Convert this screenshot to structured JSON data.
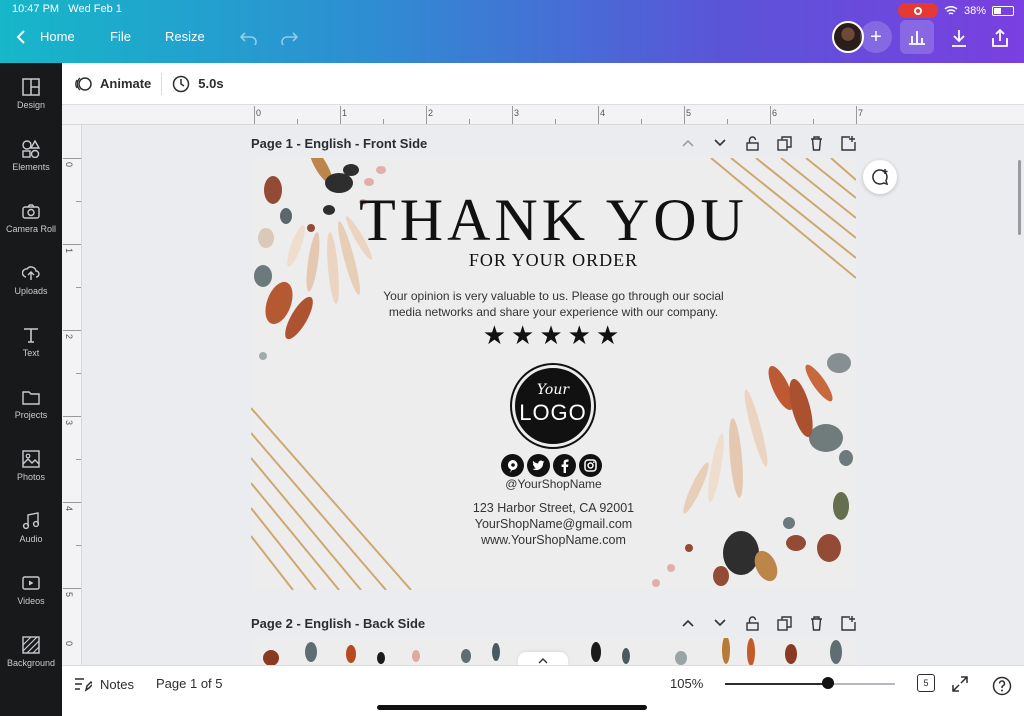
{
  "status_bar": {
    "time": "10:47 PM",
    "date": "Wed Feb 1",
    "battery": "38%"
  },
  "nav": {
    "home": "Home",
    "file": "File",
    "resize": "Resize"
  },
  "sidebar": {
    "items": [
      {
        "label": "Design",
        "icon": "design-icon"
      },
      {
        "label": "Elements",
        "icon": "elements-icon"
      },
      {
        "label": "Camera Roll",
        "icon": "camera-icon"
      },
      {
        "label": "Uploads",
        "icon": "upload-icon"
      },
      {
        "label": "Text",
        "icon": "text-icon"
      },
      {
        "label": "Projects",
        "icon": "folder-icon"
      },
      {
        "label": "Photos",
        "icon": "photo-icon"
      },
      {
        "label": "Audio",
        "icon": "music-icon"
      },
      {
        "label": "Videos",
        "icon": "video-icon"
      },
      {
        "label": "Background",
        "icon": "background-icon"
      }
    ]
  },
  "toolbar": {
    "animate": "Animate",
    "duration": "5.0s"
  },
  "ruler": {
    "top_labels": [
      "0",
      "1",
      "2",
      "3",
      "4",
      "5",
      "6",
      "7"
    ],
    "left_labels": [
      "0",
      "1",
      "2",
      "3",
      "4",
      "5",
      "0"
    ]
  },
  "pages": [
    {
      "title": "Page 1 - English - Front Side"
    },
    {
      "title": "Page 2 - English - Back Side"
    }
  ],
  "card": {
    "heading": "THANK YOU",
    "subheading": "FOR YOUR ORDER",
    "opinion_line1": "Your opinion is very valuable to us. Please go through our social",
    "opinion_line2": "media networks and share your experience with our company.",
    "stars": "★★★★★",
    "logo_top": "Your",
    "logo_main": "LOGO",
    "social_icons": [
      "pinterest-icon",
      "twitter-icon",
      "facebook-icon",
      "instagram-icon"
    ],
    "handle": "@YourShopName",
    "address": "123 Harbor Street, CA 92001",
    "email": "YourShopName@gmail.com",
    "website": "www.YourShopName.com"
  },
  "bottom": {
    "notes": "Notes",
    "page_indicator": "Page 1 of 5",
    "zoom": "105%",
    "page_count": "5"
  },
  "colors": {
    "accent_gradient_start": "#16b7c9",
    "accent_gradient_end": "#7a3fe0",
    "sidebar_bg": "#18191b"
  }
}
